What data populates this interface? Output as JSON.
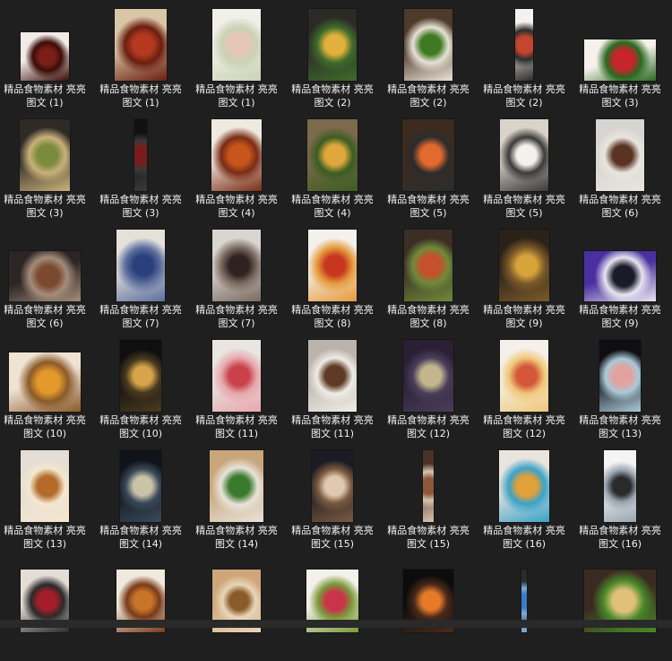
{
  "items": [
    {
      "label": "精品食物素材 亮亮图文 (1)",
      "colors": [
        "#f0ebe6",
        "#7a1f18",
        "#3b0d08"
      ],
      "tw": 54,
      "th": 54
    },
    {
      "label": "精品食物素材 亮亮图文 (1)",
      "colors": [
        "#d9c6a7",
        "#b33a1f",
        "#6b1e10"
      ],
      "tw": 58,
      "th": 80
    },
    {
      "label": "精品食物素材 亮亮图文 (1)",
      "colors": [
        "#f1efe9",
        "#e6c6b6",
        "#c9d3b5"
      ],
      "tw": 54,
      "th": 80
    },
    {
      "label": "精品食物素材 亮亮图文 (2)",
      "colors": [
        "#2c2a27",
        "#e0b13c",
        "#3e6b2b"
      ],
      "tw": 54,
      "th": 80
    },
    {
      "label": "精品食物素材 亮亮图文 (2)",
      "colors": [
        "#4e3a2a",
        "#3f7a23",
        "#e8e2d6"
      ],
      "tw": 54,
      "th": 80
    },
    {
      "label": "精品食物素材 亮亮图文 (2)",
      "colors": [
        "#f5f1ee",
        "#c5452f",
        "#2c2c2c"
      ],
      "tw": 20,
      "th": 80
    },
    {
      "label": "精品食物素材 亮亮图文 (3)",
      "colors": [
        "#f6f1ec",
        "#c7242b",
        "#2b6a22"
      ],
      "tw": 80,
      "th": 46
    },
    {
      "label": "精品食物素材 亮亮图文 (3)",
      "colors": [
        "#2e2a26",
        "#7c8a3e",
        "#c9b17a"
      ],
      "tw": 56,
      "th": 80
    },
    {
      "label": "精品食物素材 亮亮图文 (3)",
      "colors": [
        "#111111",
        "#7a1c1c",
        "#3a3a3a"
      ],
      "tw": 14,
      "th": 80
    },
    {
      "label": "精品食物素材 亮亮图文 (4)",
      "colors": [
        "#efe9df",
        "#c8561c",
        "#7a2c15"
      ],
      "tw": 56,
      "th": 80
    },
    {
      "label": "精品食物素材 亮亮图文 (4)",
      "colors": [
        "#7c6a4c",
        "#e0a73c",
        "#3b5d22"
      ],
      "tw": 56,
      "th": 80
    },
    {
      "label": "精品食物素材 亮亮图文 (5)",
      "colors": [
        "#3d2b20",
        "#e26a2f",
        "#2c2c2c"
      ],
      "tw": 58,
      "th": 80
    },
    {
      "label": "精品食物素材 亮亮图文 (5)",
      "colors": [
        "#d9d3c9",
        "#f4f1ec",
        "#3a3a3a"
      ],
      "tw": 54,
      "th": 80
    },
    {
      "label": "精品食物素材 亮亮图文 (6)",
      "colors": [
        "#d7d5d2",
        "#5a3322",
        "#e9e4de"
      ],
      "tw": 54,
      "th": 80
    },
    {
      "label": "精品食物素材 亮亮图文 (6)",
      "colors": [
        "#2b2523",
        "#7a4a2f",
        "#a48c7a"
      ],
      "tw": 80,
      "th": 56
    },
    {
      "label": "精品食物素材 亮亮图文 (7)",
      "colors": [
        "#e4e1db",
        "#2b3f7c",
        "#5d6f9e"
      ],
      "tw": 54,
      "th": 80
    },
    {
      "label": "精品食物素材 亮亮图文 (7)",
      "colors": [
        "#d9d6d1",
        "#2f2321",
        "#7a6a60"
      ],
      "tw": 54,
      "th": 80
    },
    {
      "label": "精品食物素材 亮亮图文 (8)",
      "colors": [
        "#f4f1ec",
        "#c7361f",
        "#e69a3c"
      ],
      "tw": 54,
      "th": 80
    },
    {
      "label": "精品食物素材 亮亮图文 (8)",
      "colors": [
        "#3a2e25",
        "#c4502c",
        "#6f8a3a"
      ],
      "tw": 54,
      "th": 80
    },
    {
      "label": "精品食物素材 亮亮图文 (9)",
      "colors": [
        "#2c2118",
        "#d8a43a",
        "#7a5a2a"
      ],
      "tw": 56,
      "th": 80
    },
    {
      "label": "精品食物素材 亮亮图文 (9)",
      "colors": [
        "#4a2fa0",
        "#1b1a2a",
        "#e8e6f0"
      ],
      "tw": 80,
      "th": 56
    },
    {
      "label": "精品食物素材 亮亮图文 (10)",
      "colors": [
        "#efe3d4",
        "#e49a2a",
        "#8a5a2a"
      ],
      "tw": 80,
      "th": 66
    },
    {
      "label": "精品食物素材 亮亮图文 (10)",
      "colors": [
        "#0f0f10",
        "#d6a44a",
        "#4a3a1f"
      ],
      "tw": 46,
      "th": 80
    },
    {
      "label": "精品食物素材 亮亮图文 (11)",
      "colors": [
        "#e9e5e1",
        "#c9414a",
        "#e7a7ad"
      ],
      "tw": 54,
      "th": 80
    },
    {
      "label": "精品食物素材 亮亮图文 (11)",
      "colors": [
        "#b9b3ac",
        "#5e3a25",
        "#f0ece6"
      ],
      "tw": 54,
      "th": 80
    },
    {
      "label": "精品食物素材 亮亮图文 (12)",
      "colors": [
        "#2a1f33",
        "#c4b68c",
        "#4a3d5a"
      ],
      "tw": 56,
      "th": 80
    },
    {
      "label": "精品食物素材 亮亮图文 (12)",
      "colors": [
        "#f5f1ea",
        "#d4573a",
        "#f0c77a"
      ],
      "tw": 54,
      "th": 80
    },
    {
      "label": "精品食物素材 亮亮图文 (13)",
      "colors": [
        "#0f0f12",
        "#e2a2a0",
        "#a9c9d9"
      ],
      "tw": 46,
      "th": 80
    },
    {
      "label": "精品食物素材 亮亮图文 (13)",
      "colors": [
        "#e4ddd4",
        "#b36a2a",
        "#f4e7cf"
      ],
      "tw": 54,
      "th": 80
    },
    {
      "label": "精品食物素材 亮亮图文 (14)",
      "colors": [
        "#11131a",
        "#c9c3a8",
        "#3a4a5a"
      ],
      "tw": 46,
      "th": 80
    },
    {
      "label": "精品食物素材 亮亮图文 (14)",
      "colors": [
        "#c8a57a",
        "#3a7a2e",
        "#e9e3da"
      ],
      "tw": 60,
      "th": 80
    },
    {
      "label": "精品食物素材 亮亮图文 (15)",
      "colors": [
        "#1c1a22",
        "#e0c9b0",
        "#7a5a40"
      ],
      "tw": 46,
      "th": 80
    },
    {
      "label": "精品食物素材 亮亮图文 (15)",
      "colors": [
        "#4a3226",
        "#8a5a3a",
        "#d9c4b0"
      ],
      "tw": 12,
      "th": 80
    },
    {
      "label": "精品食物素材 亮亮图文 (16)",
      "colors": [
        "#e9e4de",
        "#e0a03a",
        "#3aa3c9"
      ],
      "tw": 56,
      "th": 80
    },
    {
      "label": "精品食物素材 亮亮图文 (16)",
      "colors": [
        "#f4f4f4",
        "#2a2a2a",
        "#9aa5b0"
      ],
      "tw": 36,
      "th": 80
    },
    {
      "label": "",
      "colors": [
        "#e4ddd6",
        "#a31e2a",
        "#2a2a2a"
      ],
      "tw": 54,
      "th": 70
    },
    {
      "label": "",
      "colors": [
        "#f0e9dd",
        "#c8752a",
        "#7a3a1a"
      ],
      "tw": 54,
      "th": 70
    },
    {
      "label": "",
      "colors": [
        "#cfa67a",
        "#8a5a2a",
        "#e9d6b8"
      ],
      "tw": 54,
      "th": 70
    },
    {
      "label": "",
      "colors": [
        "#f4f0ea",
        "#c9344a",
        "#7a9a3a"
      ],
      "tw": 58,
      "th": 70
    },
    {
      "label": "",
      "colors": [
        "#0c0c0c",
        "#e67a2a",
        "#4a2a1a"
      ],
      "tw": 56,
      "th": 70
    },
    {
      "label": "",
      "colors": [
        "#2c2c2c",
        "#3a7ac9",
        "#7ab0e0"
      ],
      "tw": 6,
      "th": 70
    },
    {
      "label": "",
      "colors": [
        "#3a2a20",
        "#e0c07a",
        "#4a8a2a"
      ],
      "tw": 80,
      "th": 70
    }
  ]
}
